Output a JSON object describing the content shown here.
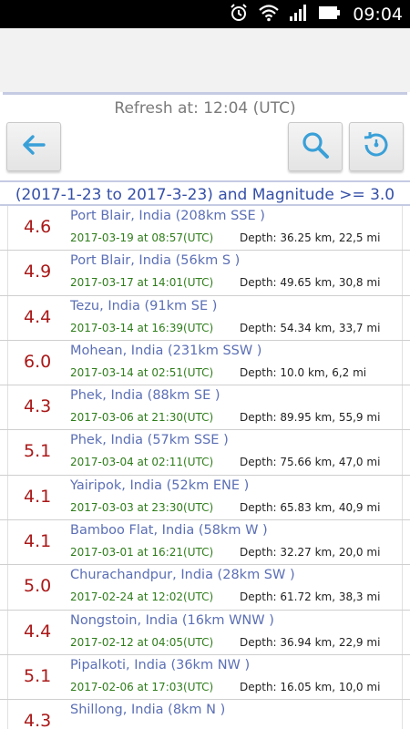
{
  "status_bar": {
    "time": "09:04"
  },
  "refresh_text": "Refresh at: 12:04 (UTC)",
  "range_text": "(2017-1-23 to 2017-3-23) and Magnitude >= 3.0",
  "colors": {
    "magnitude": "#aa1818",
    "place": "#5b6fb5",
    "date": "#2e7d1a",
    "accent": "#3aa0d8"
  },
  "icons": [
    "alarm-icon",
    "wifi-icon",
    "signal-icon",
    "battery-icon",
    "back-arrow-icon",
    "search-icon",
    "history-icon"
  ],
  "quakes": [
    {
      "mag": "4.6",
      "place": "Port Blair, India (208km SSE )",
      "date": "2017-03-19 at 08:57(UTC)",
      "depth": "Depth: 36.25 km, 22,5 mi"
    },
    {
      "mag": "4.9",
      "place": "Port Blair, India (56km S )",
      "date": "2017-03-17 at 14:01(UTC)",
      "depth": "Depth: 49.65 km, 30,8 mi"
    },
    {
      "mag": "4.4",
      "place": "Tezu, India (91km SE )",
      "date": "2017-03-14 at 16:39(UTC)",
      "depth": "Depth: 54.34 km, 33,7 mi"
    },
    {
      "mag": "6.0",
      "place": "Mohean, India (231km SSW )",
      "date": "2017-03-14 at 02:51(UTC)",
      "depth": "Depth: 10.0 km, 6,2 mi"
    },
    {
      "mag": "4.3",
      "place": "Phek, India (88km SE )",
      "date": "2017-03-06 at 21:30(UTC)",
      "depth": "Depth: 89.95 km, 55,9 mi"
    },
    {
      "mag": "5.1",
      "place": "Phek, India (57km SSE )",
      "date": "2017-03-04 at 02:11(UTC)",
      "depth": "Depth: 75.66 km, 47,0 mi"
    },
    {
      "mag": "4.1",
      "place": "Yairipok, India (52km ENE )",
      "date": "2017-03-03 at 23:30(UTC)",
      "depth": "Depth: 65.83 km, 40,9 mi"
    },
    {
      "mag": "4.1",
      "place": "Bamboo Flat, India (58km W )",
      "date": "2017-03-01 at 16:21(UTC)",
      "depth": "Depth: 32.27 km, 20,0 mi"
    },
    {
      "mag": "5.0",
      "place": "Churachandpur, India (28km SW )",
      "date": "2017-02-24 at 12:02(UTC)",
      "depth": "Depth: 61.72 km, 38,3 mi"
    },
    {
      "mag": "4.4",
      "place": "Nongstoin, India (16km WNW )",
      "date": "2017-02-12 at 04:05(UTC)",
      "depth": "Depth: 36.94 km, 22,9 mi"
    },
    {
      "mag": "5.1",
      "place": "Pipalkoti, India (36km NW )",
      "date": "2017-02-06 at 17:03(UTC)",
      "depth": "Depth: 16.05 km, 10,0 mi"
    },
    {
      "mag": "4.3",
      "place": "Shillong, India (8km N )",
      "date": "",
      "depth": ""
    }
  ]
}
